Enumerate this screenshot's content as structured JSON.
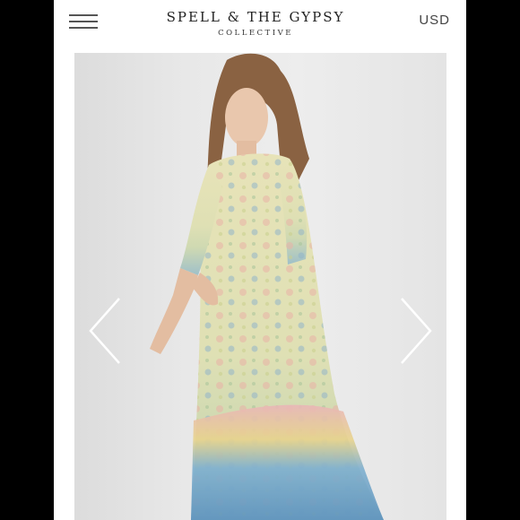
{
  "header": {
    "brand_name": "SPELL & THE GYPSY",
    "brand_sub": "COLLECTIVE",
    "currency": "USD",
    "menu_icon": "hamburger-menu-icon"
  },
  "gallery": {
    "image_alt": "Model wearing a floral boho maxi dress",
    "prev_icon": "chevron-left-icon",
    "next_icon": "chevron-right-icon"
  },
  "colors": {
    "page_bg": "#000000",
    "screen_bg": "#ffffff",
    "text": "#222222",
    "arrow": "#ffffff"
  }
}
